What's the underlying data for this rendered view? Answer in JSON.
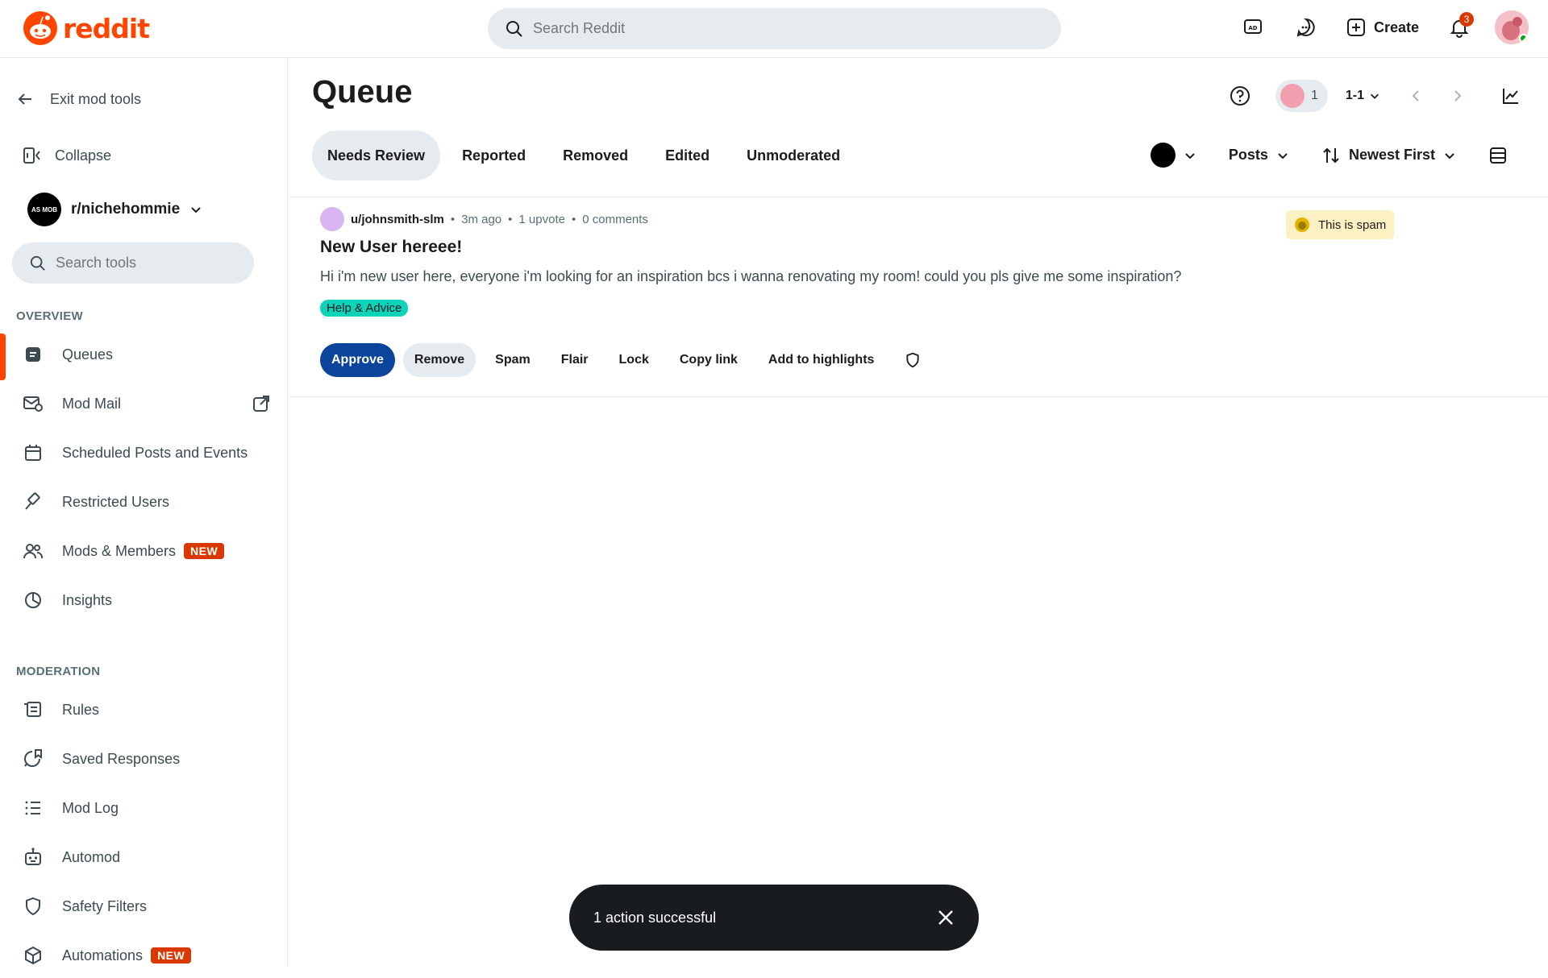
{
  "header": {
    "logo_text": "reddit",
    "search_placeholder": "Search Reddit",
    "create_label": "Create",
    "notification_count": "3"
  },
  "sidebar": {
    "exit_label": "Exit mod tools",
    "collapse_label": "Collapse",
    "subreddit_name": "r/nichehommie",
    "subreddit_avatar_text": "AS MOB",
    "search_tools_placeholder": "Search tools",
    "overview_heading": "OVERVIEW",
    "moderation_heading": "MODERATION",
    "new_badge": "NEW",
    "overview_items": [
      {
        "label": "Queues",
        "icon": "queue-icon"
      },
      {
        "label": "Mod Mail",
        "icon": "mail-icon"
      },
      {
        "label": "Scheduled Posts and Events",
        "icon": "calendar-icon"
      },
      {
        "label": "Restricted Users",
        "icon": "gavel-icon"
      },
      {
        "label": "Mods & Members",
        "icon": "members-icon"
      },
      {
        "label": "Insights",
        "icon": "pie-icon"
      }
    ],
    "moderation_items": [
      {
        "label": "Rules",
        "icon": "scroll-icon"
      },
      {
        "label": "Saved Responses",
        "icon": "saved-responses-icon"
      },
      {
        "label": "Mod Log",
        "icon": "list-icon"
      },
      {
        "label": "Automod",
        "icon": "robot-icon"
      },
      {
        "label": "Safety Filters",
        "icon": "shield-icon"
      },
      {
        "label": "Automations",
        "icon": "cube-icon"
      }
    ]
  },
  "main": {
    "title": "Queue",
    "mod_count": "1",
    "range": "1-1",
    "tabs": [
      "Needs Review",
      "Reported",
      "Removed",
      "Edited",
      "Unmoderated"
    ],
    "active_tab": "Needs Review",
    "filter_type": "Posts",
    "sort": "Newest First"
  },
  "post": {
    "author": "u/johnsmith-slm",
    "age": "3m ago",
    "upvotes": "1 upvote",
    "comments": "0 comments",
    "title": "New User hereee!",
    "body": "Hi i'm new user here, everyone i'm looking for an inspiration bcs i wanna renovating my room! could you pls give me some inspiration?",
    "flair": "Help & Advice",
    "spam_label": "This is spam",
    "actions": [
      "Approve",
      "Remove",
      "Spam",
      "Flair",
      "Lock",
      "Copy link",
      "Add to highlights"
    ]
  },
  "toast": {
    "message": "1 action successful"
  },
  "colors": {
    "brand": "#ff4500",
    "approve": "#0a449b",
    "flair": "#0dd3bb",
    "new_badge": "#d93900"
  }
}
